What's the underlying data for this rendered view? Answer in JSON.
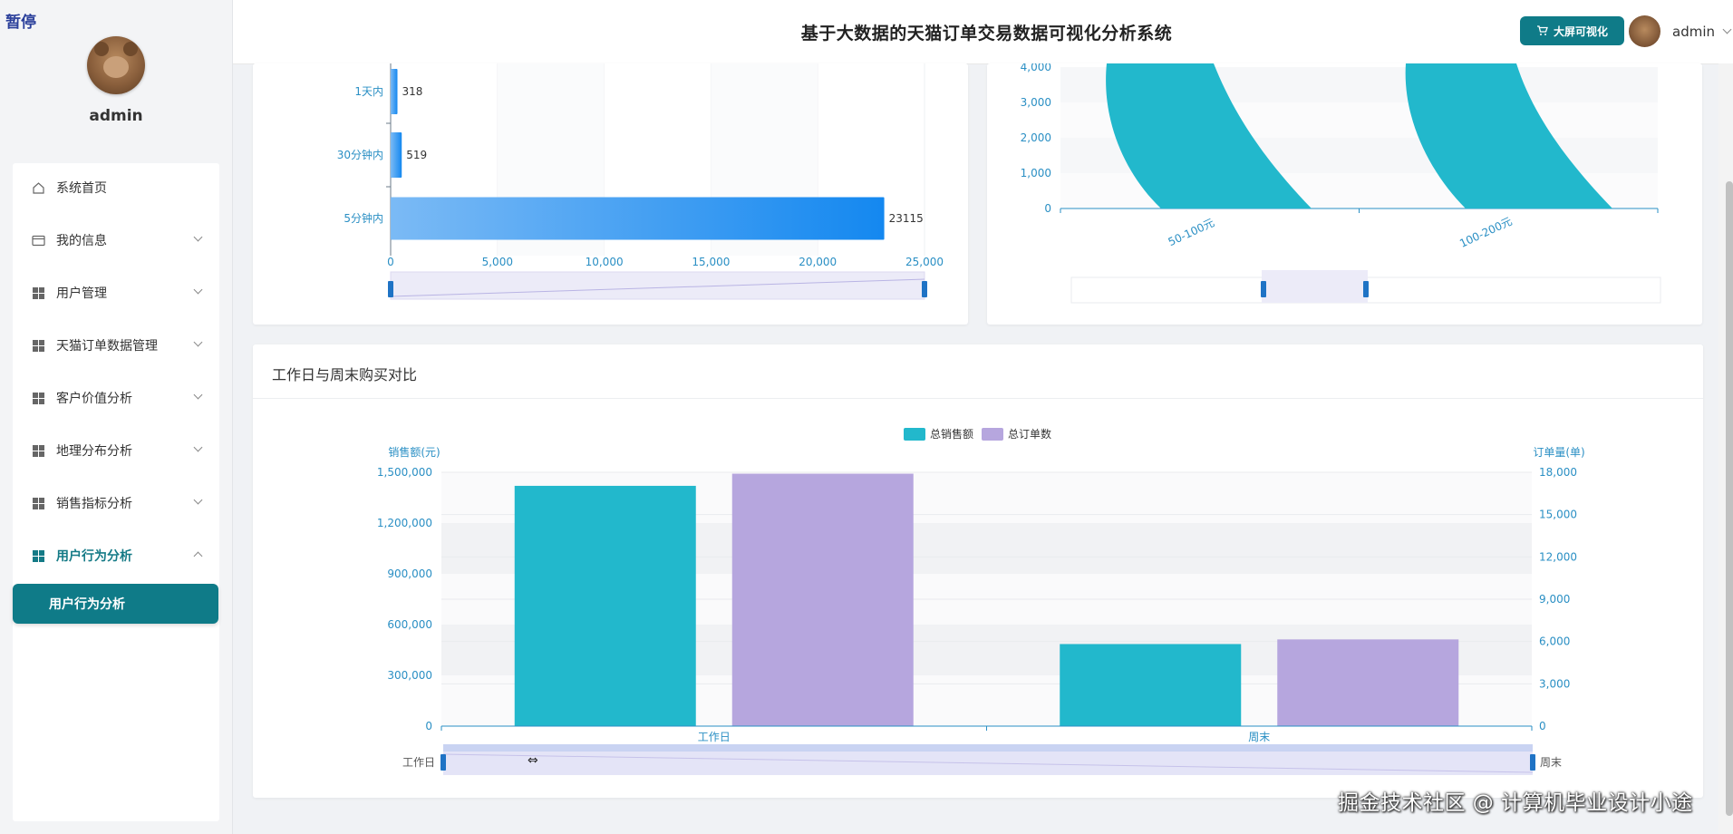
{
  "overlay": {
    "pause_label": "暂停"
  },
  "sidebar": {
    "username": "admin",
    "items": [
      {
        "label": "系统首页",
        "icon": "home-icon",
        "expandable": false
      },
      {
        "label": "我的信息",
        "icon": "card-icon",
        "expandable": true
      },
      {
        "label": "用户管理",
        "icon": "grid-icon",
        "expandable": true
      },
      {
        "label": "天猫订单数据管理",
        "icon": "grid-icon",
        "expandable": true
      },
      {
        "label": "客户价值分析",
        "icon": "grid-icon",
        "expandable": true
      },
      {
        "label": "地理分布分析",
        "icon": "grid-icon",
        "expandable": true
      },
      {
        "label": "销售指标分析",
        "icon": "grid-icon",
        "expandable": true
      },
      {
        "label": "用户行为分析",
        "icon": "grid-icon",
        "expandable": true,
        "expanded": true
      }
    ],
    "submenu_active": "用户行为分析"
  },
  "header": {
    "title": "基于大数据的天猫订单交易数据可视化分析系统",
    "bigscreen_label": "大屏可视化",
    "user": "admin"
  },
  "colors": {
    "brand": "#0f7b88",
    "teal_series": "#22b8cc",
    "purple_series": "#b6a6de",
    "blue_bar": "#1a8cf0",
    "axis_text": "#2a8fc4"
  },
  "chart_data": [
    {
      "type": "bar",
      "orientation": "horizontal",
      "categories": [
        "1天内",
        "30分钟内",
        "5分钟内"
      ],
      "values": [
        318,
        519,
        23115
      ],
      "data_labels": [
        "318",
        "519",
        "23115"
      ],
      "xlim": [
        0,
        25000
      ],
      "x_ticks": [
        "0",
        "5,000",
        "10,000",
        "15,000",
        "20,000",
        "25,000"
      ],
      "datazoom": true
    },
    {
      "type": "bar",
      "categories": [
        "50-100元",
        "100-200元"
      ],
      "y_ticks": [
        "0",
        "1,000",
        "2,000",
        "3,000",
        "4,000"
      ],
      "ylim": [
        0,
        4000
      ],
      "note_values_exceed_visible_range": true,
      "datazoom": true
    },
    {
      "type": "bar",
      "title": "工作日与周末购买对比",
      "categories": [
        "工作日",
        "周末"
      ],
      "series": [
        {
          "name": "总销售额",
          "axis": "left",
          "values": [
            1420000,
            485000
          ]
        },
        {
          "name": "总订单数",
          "axis": "right",
          "values": [
            17900,
            6150
          ]
        }
      ],
      "ylabel_left": "销售额(元)",
      "ylabel_right": "订单量(单)",
      "ylim_left": [
        0,
        1500000
      ],
      "ylim_right": [
        0,
        18000
      ],
      "y_ticks_left": [
        "0",
        "300,000",
        "600,000",
        "900,000",
        "1,200,000",
        "1,500,000"
      ],
      "y_ticks_right": [
        "0",
        "3,000",
        "6,000",
        "9,000",
        "12,000",
        "15,000",
        "18,000"
      ],
      "legend_position": "top-center",
      "datazoom": {
        "start_label": "工作日",
        "end_label": "周末"
      }
    }
  ],
  "footer": {
    "watermark": "掘金技术社区 @ 计算机毕业设计小途"
  }
}
